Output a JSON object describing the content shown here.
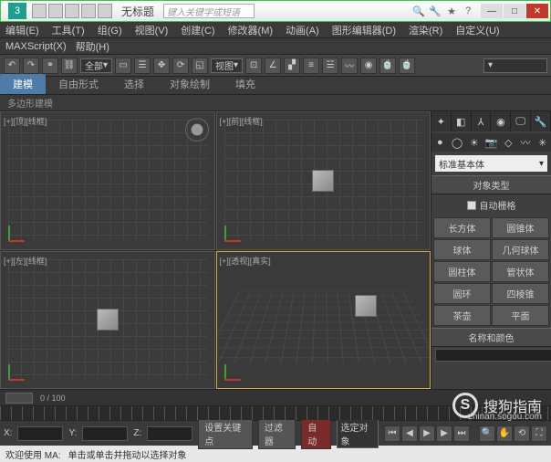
{
  "window": {
    "title": "无标题",
    "search_placeholder": "键入关键字或短语"
  },
  "menus": [
    "编辑(E)",
    "工具(T)",
    "组(G)",
    "视图(V)",
    "创建(C)",
    "修改器(M)",
    "动画(A)",
    "图形编辑器(D)",
    "渲染(R)",
    "自定义(U)"
  ],
  "scriptrow": [
    "MAXScript(X)",
    "帮助(H)"
  ],
  "toolbar": {
    "sel_all": "全部",
    "view_dd": "视图"
  },
  "ribbon": {
    "tabs": [
      "建模",
      "自由形式",
      "选择",
      "对象绘制",
      "填充"
    ],
    "sub": "多边形建模"
  },
  "viewports": [
    {
      "label": "[+][顶][线框]"
    },
    {
      "label": "[+][前][线框]"
    },
    {
      "label": "[+][左][线框]"
    },
    {
      "label": "[+][透视][真实]"
    }
  ],
  "cmdpanel": {
    "dropdown": "标准基本体",
    "rollout1": "对象类型",
    "autogrid": "自动栅格",
    "primitives": [
      [
        "长方体",
        "圆锥体"
      ],
      [
        "球体",
        "几何球体"
      ],
      [
        "圆柱体",
        "管状体"
      ],
      [
        "圆环",
        "四棱锥"
      ],
      [
        "茶壶",
        "平面"
      ]
    ],
    "rollout2": "名称和颜色",
    "swatch_color": "#8a6d3b"
  },
  "timeline": {
    "range": "0 / 100",
    "autokey": "自动",
    "setkey_dd": "选定对象",
    "coord_label": "设置关键点",
    "filter_label": "过滤器"
  },
  "status": {
    "welcome": "欢迎使用 MA:",
    "prompt": "单击或单击并拖动以选择对象"
  },
  "watermark": {
    "brand": "搜狗指南",
    "url": "zhinan.sogou.com"
  }
}
